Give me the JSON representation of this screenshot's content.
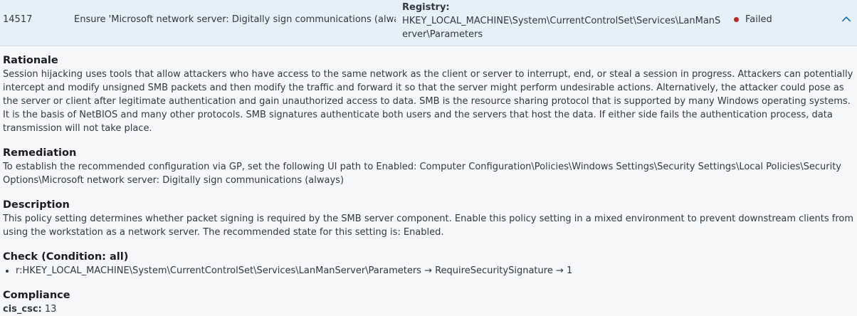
{
  "row": {
    "id": "14517",
    "title": "Ensure 'Microsoft network server: Digitally sign communications (always)'...",
    "target_label": "Registry:",
    "target_value": "HKEY_LOCAL_MACHINE\\System\\CurrentControlSet\\Services\\LanManServer\\Parameters",
    "result": "Failed",
    "result_color": "#bd271e",
    "toggle_icon": "chevron-up-icon"
  },
  "details": {
    "rationale": {
      "heading": "Rationale",
      "text": "Session hijacking uses tools that allow attackers who have access to the same network as the client or server to interrupt, end, or steal a session in progress. Attackers can potentially intercept and modify unsigned SMB packets and then modify the traffic and forward it so that the server might perform undesirable actions. Alternatively, the attacker could pose as the server or client after legitimate authentication and gain unauthorized access to data. SMB is the resource sharing protocol that is supported by many Windows operating systems. It is the basis of NetBIOS and many other protocols. SMB signatures authenticate both users and the servers that host the data. If either side fails the authentication process, data transmission will not take place."
    },
    "remediation": {
      "heading": "Remediation",
      "text": "To establish the recommended configuration via GP, set the following UI path to Enabled: Computer Configuration\\Policies\\Windows Settings\\Security Settings\\Local Policies\\Security Options\\Microsoft network server: Digitally sign communications (always)"
    },
    "description": {
      "heading": "Description",
      "text": "This policy setting determines whether packet signing is required by the SMB server component. Enable this policy setting in a mixed environment to prevent downstream clients from using the workstation as a network server. The recommended state for this setting is: Enabled."
    },
    "check": {
      "heading": "Check (Condition: all)",
      "items": [
        "r:HKEY_LOCAL_MACHINE\\System\\CurrentControlSet\\Services\\LanManServer\\Parameters → RequireSecuritySignature → 1"
      ]
    },
    "compliance": {
      "heading": "Compliance",
      "key": "cis_csc:",
      "value": "13"
    }
  }
}
